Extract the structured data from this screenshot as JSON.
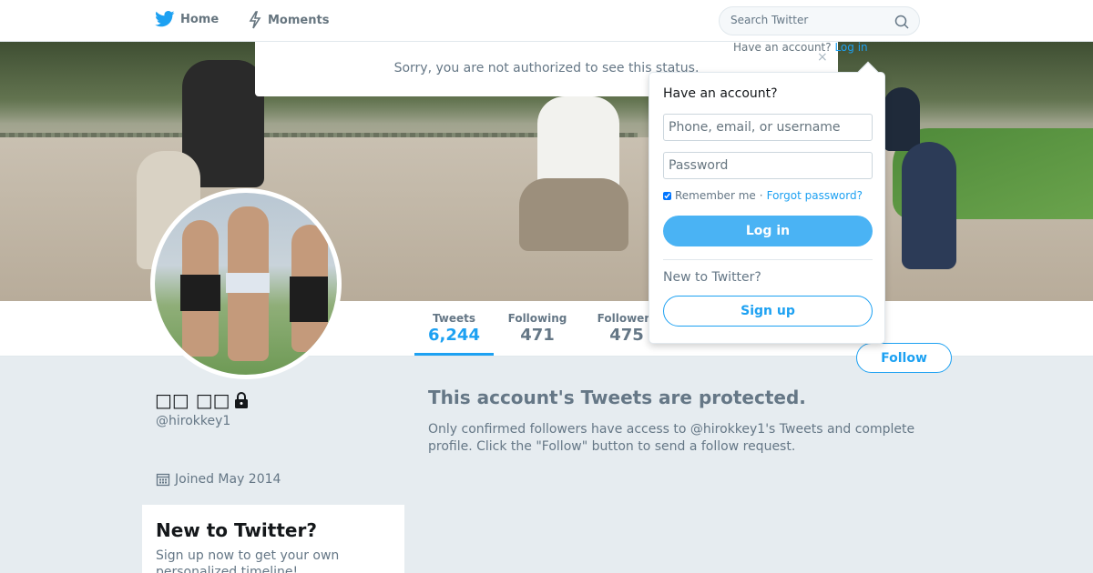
{
  "nav": {
    "home_label": "Home",
    "moments_label": "Moments",
    "search_placeholder": "Search Twitter"
  },
  "header_login": {
    "prompt": "Have an account?",
    "link": "Log in"
  },
  "notice": {
    "text": "Sorry, you are not authorized to see this status.",
    "close_glyph": "×"
  },
  "profile": {
    "name": "□□ □□",
    "handle": "@hirokkey1",
    "joined": "Joined May 2014",
    "stats": {
      "tweets_label": "Tweets",
      "tweets_value": "6,244",
      "following_label": "Following",
      "following_value": "471",
      "followers_label": "Followers",
      "followers_value": "475"
    },
    "follow_label": "Follow"
  },
  "protected": {
    "title": "This account's Tweets are protected.",
    "text": "Only confirmed followers have access to @hirokkey1's Tweets and complete profile. Click the \"Follow\" button to send a follow request."
  },
  "new_card": {
    "title": "New to Twitter?",
    "text": "Sign up now to get your own personalized timeline!"
  },
  "login_dropdown": {
    "heading": "Have an account?",
    "username_placeholder": "Phone, email, or username",
    "password_placeholder": "Password",
    "remember_label": "Remember me",
    "separator": "·",
    "forgot_label": "Forgot password?",
    "login_label": "Log in",
    "new_label": "New to Twitter?",
    "signup_label": "Sign up"
  },
  "colors": {
    "accent": "#1da1f2",
    "background": "#e6ecf0",
    "muted_text": "#657786"
  },
  "icons": [
    "twitter-bird-icon",
    "moments-bolt-icon",
    "search-icon",
    "lock-icon",
    "calendar-icon",
    "close-icon"
  ]
}
